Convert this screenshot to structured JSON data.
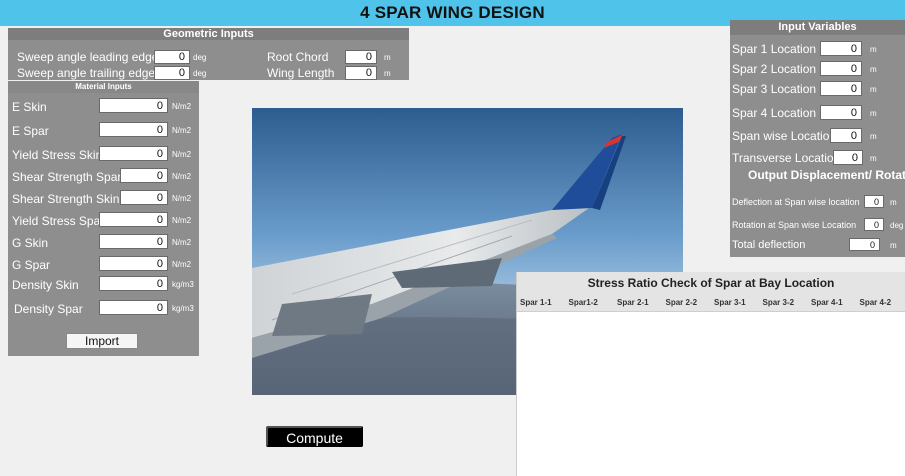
{
  "app_title": "4 SPAR WING DESIGN",
  "geometric": {
    "title": "Geometric Inputs",
    "sweep_le": {
      "label": "Sweep angle leading edge",
      "value": "0",
      "unit": "deg"
    },
    "sweep_te": {
      "label": "Sweep angle trailing edge",
      "value": "0",
      "unit": "deg"
    },
    "root_chord": {
      "label": "Root Chord",
      "value": "0",
      "unit": "m"
    },
    "wing_length": {
      "label": "Wing Length",
      "value": "0",
      "unit": "m"
    }
  },
  "material": {
    "title": "Material Inputs",
    "fields": [
      {
        "label": "E Skin",
        "value": "0",
        "unit": "N/m2"
      },
      {
        "label": "E Spar",
        "value": "0",
        "unit": "N/m2"
      },
      {
        "label": "Yield Stress Skin",
        "value": "0",
        "unit": "N/m2"
      },
      {
        "label": "Shear Strength Spar",
        "value": "0",
        "unit": "N/m2"
      },
      {
        "label": "Shear Strength Skin",
        "value": "0",
        "unit": "N/m2"
      },
      {
        "label": "Yield Stress Spar",
        "value": "0",
        "unit": "N/m2"
      },
      {
        "label": "G Skin",
        "value": "0",
        "unit": "N/m2"
      },
      {
        "label": "G Spar",
        "value": "0",
        "unit": "N/m2"
      },
      {
        "label": "Density Skin",
        "value": "0",
        "unit": "kg/m3"
      },
      {
        "label": "Density Spar",
        "value": "0",
        "unit": "kg/m3"
      }
    ],
    "import_label": "Import"
  },
  "input_variables": {
    "title": "Input Variables",
    "fields": [
      {
        "label": "Spar 1 Location",
        "value": "0",
        "unit": "m"
      },
      {
        "label": "Spar 2 Location",
        "value": "0",
        "unit": "m"
      },
      {
        "label": "Spar 3 Location",
        "value": "0",
        "unit": "m"
      },
      {
        "label": "Spar 4 Location",
        "value": "0",
        "unit": "m"
      },
      {
        "label": "Span wise Location",
        "value": "0",
        "unit": "m"
      },
      {
        "label": "Transverse Location",
        "value": "0",
        "unit": "m"
      }
    ]
  },
  "output": {
    "title": "Output Displacement/ Rotation",
    "fields": [
      {
        "label": "Deflection at Span wise location",
        "value": "0",
        "unit": "m"
      },
      {
        "label": "Rotation at Span wise Location",
        "value": "0",
        "unit": "deg"
      },
      {
        "label": "Total deflection",
        "value": "0",
        "unit": "m"
      }
    ]
  },
  "stress_table": {
    "title": "Stress Ratio Check of Spar at Bay Location",
    "columns": [
      "Spar 1-1",
      "Spar1-2",
      "Spar 2-1",
      "Spar 2-2",
      "Spar 3-1",
      "Spar 3-2",
      "Spar 4-1",
      "Spar 4-2"
    ]
  },
  "compute_label": "Compute",
  "colors": {
    "title_bar": "#4fc3ea",
    "panel": "#8e8e8e",
    "button_dark": "#000000"
  },
  "image_subject": "airplane-wing-photo"
}
